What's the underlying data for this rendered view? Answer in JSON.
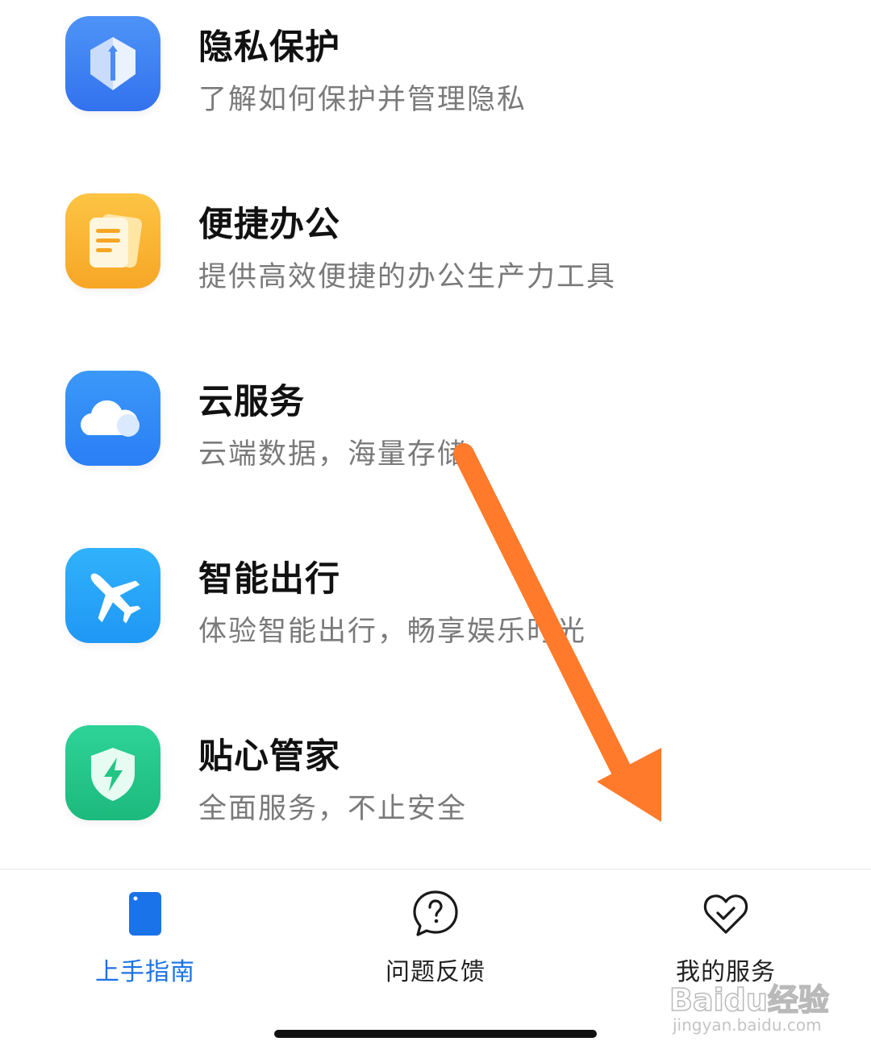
{
  "items": [
    {
      "title": "隐私保护",
      "subtitle": "了解如何保护并管理隐私",
      "icon": "privacy-shield-icon",
      "color": "#3f86f4"
    },
    {
      "title": "便捷办公",
      "subtitle": "提供高效便捷的办公生产力工具",
      "icon": "document-icon",
      "color": "#fbb234"
    },
    {
      "title": "云服务",
      "subtitle": "云端数据，海量存储",
      "icon": "cloud-icon",
      "color": "#2f8cf7"
    },
    {
      "title": "智能出行",
      "subtitle": "体验智能出行，畅享娱乐时光",
      "icon": "airplane-icon",
      "color": "#29a6f8"
    },
    {
      "title": "贴心管家",
      "subtitle": "全面服务，不止安全",
      "icon": "shield-bolt-icon",
      "color": "#23c88b"
    }
  ],
  "tabs": [
    {
      "label": "上手指南",
      "icon": "phone-icon",
      "active": true
    },
    {
      "label": "问题反馈",
      "icon": "question-bubble-icon",
      "active": false
    },
    {
      "label": "我的服务",
      "icon": "heart-check-icon",
      "active": false
    }
  ],
  "colors": {
    "accent": "#1a73e8",
    "arrow": "#ff7a2a"
  },
  "watermark": {
    "brand": "Baidu经验",
    "url": "jingyan.baidu.com"
  }
}
